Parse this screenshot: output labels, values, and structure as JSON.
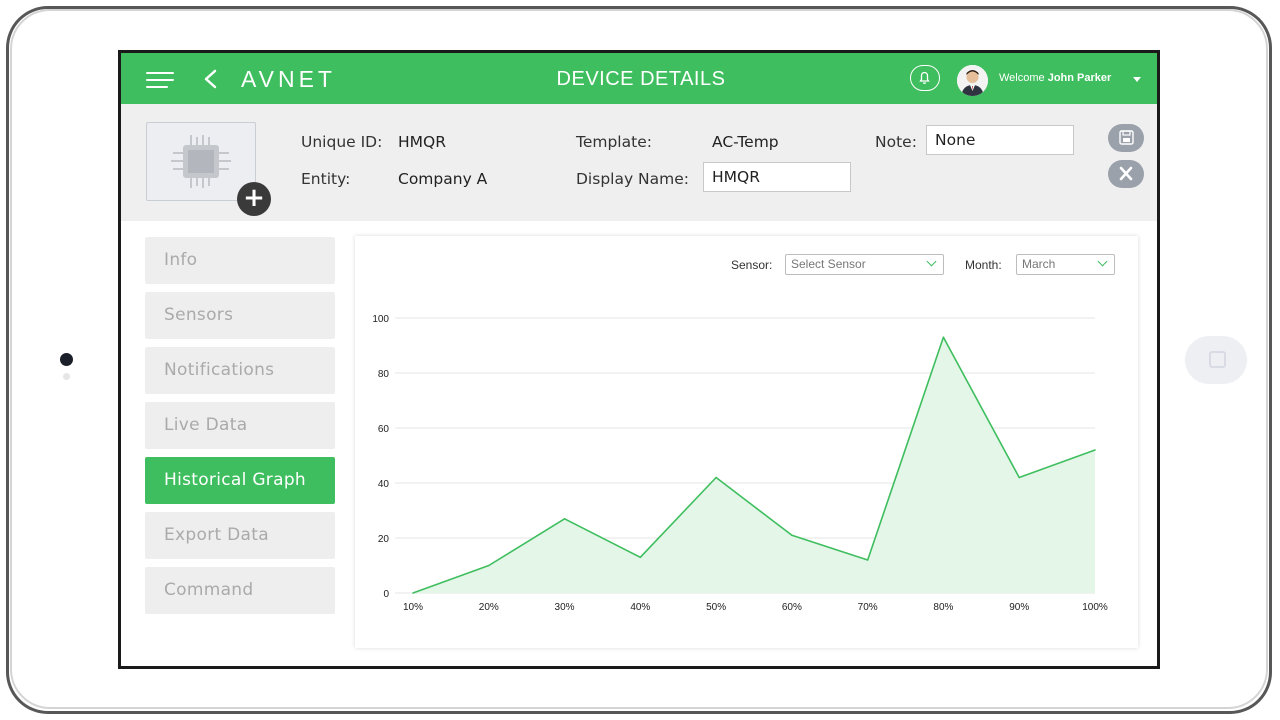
{
  "header": {
    "title": "DEVICE DETAILS",
    "logo": "AVNET",
    "welcome_prefix": "Welcome",
    "user_name": "John Parker"
  },
  "device": {
    "unique_id_label": "Unique ID:",
    "unique_id": "HMQR",
    "entity_label": "Entity:",
    "entity": "Company A",
    "template_label": "Template:",
    "template": "AC-Temp",
    "display_name_label": "Display Name:",
    "display_name": "HMQR",
    "note_label": "Note:",
    "note": "None"
  },
  "tabs": [
    {
      "label": "Info",
      "active": false
    },
    {
      "label": "Sensors",
      "active": false
    },
    {
      "label": "Notifications",
      "active": false
    },
    {
      "label": "Live Data",
      "active": false
    },
    {
      "label": "Historical Graph",
      "active": true
    },
    {
      "label": "Export Data",
      "active": false
    },
    {
      "label": "Command",
      "active": false
    }
  ],
  "filters": {
    "sensor_label": "Sensor:",
    "sensor_placeholder": "Select Sensor",
    "month_label": "Month:",
    "month_value": "March"
  },
  "colors": {
    "accent": "#3ebe5e",
    "fill": "#e4f6e8",
    "grid": "#e5e5e5"
  },
  "chart_data": {
    "type": "area",
    "x": [
      "10%",
      "20%",
      "30%",
      "40%",
      "50%",
      "60%",
      "70%",
      "80%",
      "90%",
      "100%"
    ],
    "series": [
      {
        "values": [
          0,
          10,
          27,
          13,
          42,
          21,
          12,
          93,
          42,
          52
        ]
      }
    ],
    "ylim": [
      0,
      100
    ],
    "yticks": [
      0,
      20,
      40,
      60,
      80,
      100
    ],
    "grid": true
  }
}
